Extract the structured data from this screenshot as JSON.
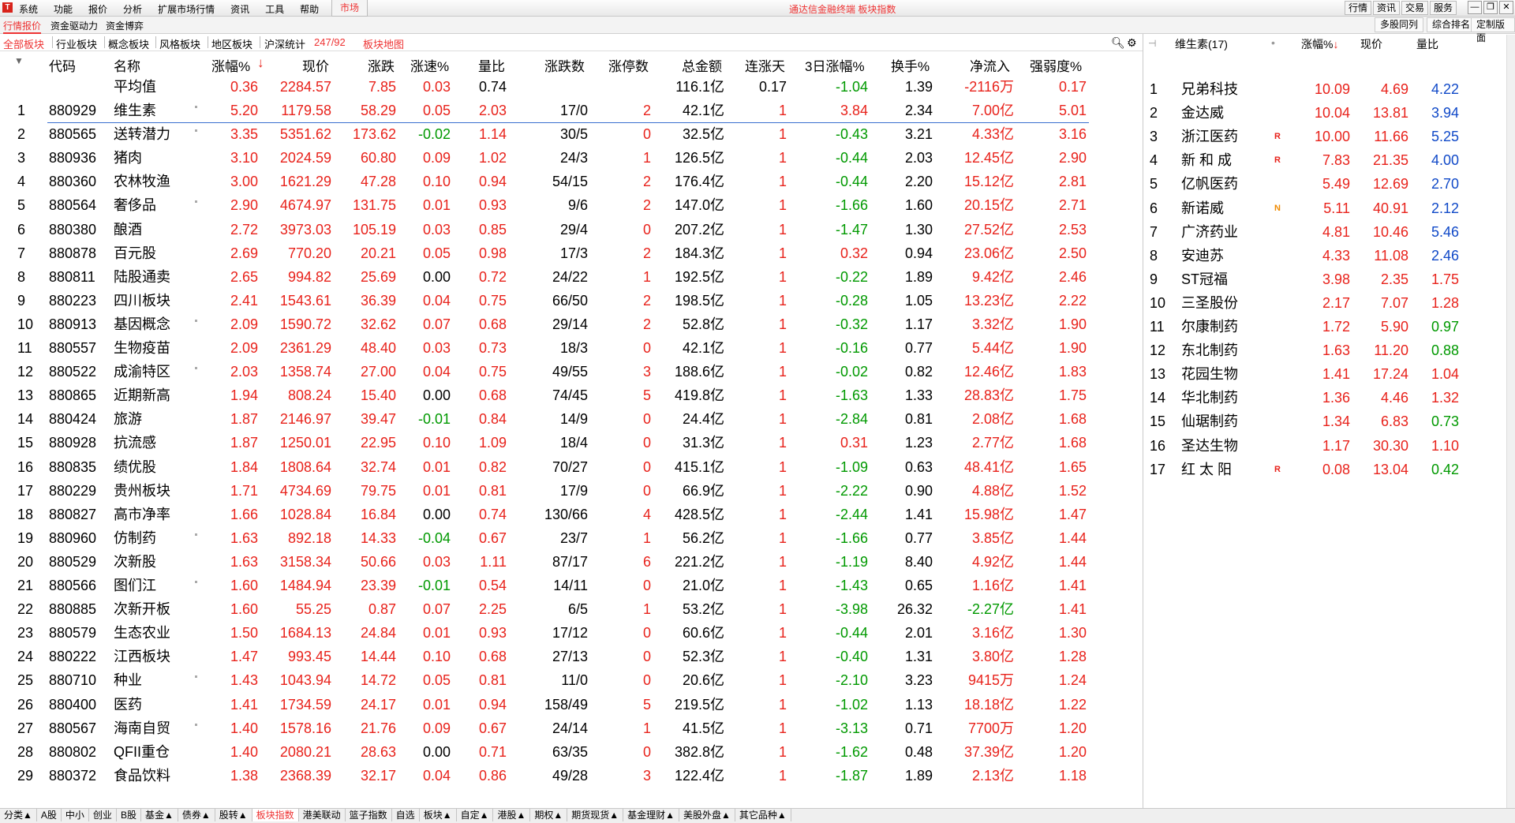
{
  "menubar": {
    "logo": "T",
    "items": [
      "系统",
      "功能",
      "报价",
      "分析",
      "扩展市场行情",
      "资讯",
      "工具",
      "帮助"
    ],
    "market": "市场",
    "title": "通达信金融终端  板块指数",
    "right_buttons": [
      "行情",
      "资讯",
      "交易",
      "服务"
    ],
    "win_buttons": [
      "—",
      "❐",
      "✕"
    ]
  },
  "bar2": {
    "tabs": [
      "行情报价",
      "资金驱动力",
      "资金博弈"
    ],
    "right": [
      "多股同列",
      "综合排名",
      "定制版面"
    ]
  },
  "bar3": {
    "tabs": [
      "全部板块",
      "行业板块",
      "概念板块",
      "风格板块",
      "地区板块",
      "沪深统计"
    ],
    "count": "247/92",
    "map": "板块地图"
  },
  "table": {
    "headers": [
      "代码",
      "名称",
      "涨幅%",
      "现价",
      "涨跌",
      "涨速%",
      "量比",
      "涨跌数",
      "涨停数",
      "总金额",
      "连涨天",
      "3日涨幅%",
      "换手%",
      "净流入",
      "强弱度%"
    ],
    "average": {
      "name": "平均值",
      "chg": "0.36",
      "price": "2284.57",
      "diff": "7.85",
      "speed": "0.03",
      "vr": "0.74",
      "count": "",
      "zt": "",
      "amount": "116.1亿",
      "days": "0.17",
      "d3": "-1.04",
      "turn": "1.39",
      "net": "-2116万",
      "strength": "0.17"
    },
    "rows": [
      [
        "1",
        "880929",
        "维生素",
        "5.20",
        "1179.58",
        "58.29",
        "0.05",
        "2.03",
        "17/0",
        "2",
        "42.1亿",
        "1",
        "3.84",
        "2.34",
        "7.00亿",
        "5.01"
      ],
      [
        "2",
        "880565",
        "送转潜力",
        "3.35",
        "5351.62",
        "173.62",
        "-0.02",
        "1.14",
        "30/5",
        "0",
        "32.5亿",
        "1",
        "-0.43",
        "3.21",
        "4.33亿",
        "3.16"
      ],
      [
        "3",
        "880936",
        "猪肉",
        "3.10",
        "2024.59",
        "60.80",
        "0.09",
        "1.02",
        "24/3",
        "1",
        "126.5亿",
        "1",
        "-0.44",
        "2.03",
        "12.45亿",
        "2.90"
      ],
      [
        "4",
        "880360",
        "农林牧渔",
        "3.00",
        "1621.29",
        "47.28",
        "0.10",
        "0.94",
        "54/15",
        "2",
        "176.4亿",
        "1",
        "-0.44",
        "2.20",
        "15.12亿",
        "2.81"
      ],
      [
        "5",
        "880564",
        "奢侈品",
        "2.90",
        "4674.97",
        "131.75",
        "0.01",
        "0.93",
        "9/6",
        "2",
        "147.0亿",
        "1",
        "-1.66",
        "1.60",
        "20.15亿",
        "2.71"
      ],
      [
        "6",
        "880380",
        "酿酒",
        "2.72",
        "3973.03",
        "105.19",
        "0.03",
        "0.85",
        "29/4",
        "0",
        "207.2亿",
        "1",
        "-1.47",
        "1.30",
        "27.52亿",
        "2.53"
      ],
      [
        "7",
        "880878",
        "百元股",
        "2.69",
        "770.20",
        "20.21",
        "0.05",
        "0.98",
        "17/3",
        "2",
        "184.3亿",
        "1",
        "0.32",
        "0.94",
        "23.06亿",
        "2.50"
      ],
      [
        "8",
        "880811",
        "陆股通卖",
        "2.65",
        "994.82",
        "25.69",
        "0.00",
        "0.72",
        "24/22",
        "1",
        "192.5亿",
        "1",
        "-0.22",
        "1.89",
        "9.42亿",
        "2.46"
      ],
      [
        "9",
        "880223",
        "四川板块",
        "2.41",
        "1543.61",
        "36.39",
        "0.04",
        "0.75",
        "66/50",
        "2",
        "198.5亿",
        "1",
        "-0.28",
        "1.05",
        "13.23亿",
        "2.22"
      ],
      [
        "10",
        "880913",
        "基因概念",
        "2.09",
        "1590.72",
        "32.62",
        "0.07",
        "0.68",
        "29/14",
        "2",
        "52.8亿",
        "1",
        "-0.32",
        "1.17",
        "3.32亿",
        "1.90"
      ],
      [
        "11",
        "880557",
        "生物疫苗",
        "2.09",
        "2361.29",
        "48.40",
        "0.03",
        "0.73",
        "18/3",
        "0",
        "42.1亿",
        "1",
        "-0.16",
        "0.77",
        "5.44亿",
        "1.90"
      ],
      [
        "12",
        "880522",
        "成渝特区",
        "2.03",
        "1358.74",
        "27.00",
        "0.04",
        "0.75",
        "49/55",
        "3",
        "188.6亿",
        "1",
        "-0.02",
        "0.82",
        "12.46亿",
        "1.83"
      ],
      [
        "13",
        "880865",
        "近期新高",
        "1.94",
        "808.24",
        "15.40",
        "0.00",
        "0.68",
        "74/45",
        "5",
        "419.8亿",
        "1",
        "-1.63",
        "1.33",
        "28.83亿",
        "1.75"
      ],
      [
        "14",
        "880424",
        "旅游",
        "1.87",
        "2146.97",
        "39.47",
        "-0.01",
        "0.84",
        "14/9",
        "0",
        "24.4亿",
        "1",
        "-2.84",
        "0.81",
        "2.08亿",
        "1.68"
      ],
      [
        "15",
        "880928",
        "抗流感",
        "1.87",
        "1250.01",
        "22.95",
        "0.10",
        "1.09",
        "18/4",
        "0",
        "31.3亿",
        "1",
        "0.31",
        "1.23",
        "2.77亿",
        "1.68"
      ],
      [
        "16",
        "880835",
        "绩优股",
        "1.84",
        "1808.64",
        "32.74",
        "0.01",
        "0.82",
        "70/27",
        "0",
        "415.1亿",
        "1",
        "-1.09",
        "0.63",
        "48.41亿",
        "1.65"
      ],
      [
        "17",
        "880229",
        "贵州板块",
        "1.71",
        "4734.69",
        "79.75",
        "0.01",
        "0.81",
        "17/9",
        "0",
        "66.9亿",
        "1",
        "-2.22",
        "0.90",
        "4.88亿",
        "1.52"
      ],
      [
        "18",
        "880827",
        "高市净率",
        "1.66",
        "1028.84",
        "16.84",
        "0.00",
        "0.74",
        "130/66",
        "4",
        "428.5亿",
        "1",
        "-2.44",
        "1.41",
        "15.98亿",
        "1.47"
      ],
      [
        "19",
        "880960",
        "仿制药",
        "1.63",
        "892.18",
        "14.33",
        "-0.04",
        "0.67",
        "23/7",
        "1",
        "56.2亿",
        "1",
        "-1.66",
        "0.77",
        "3.85亿",
        "1.44"
      ],
      [
        "20",
        "880529",
        "次新股",
        "1.63",
        "3158.34",
        "50.66",
        "0.03",
        "1.11",
        "87/17",
        "6",
        "221.2亿",
        "1",
        "-1.19",
        "8.40",
        "4.92亿",
        "1.44"
      ],
      [
        "21",
        "880566",
        "图们江",
        "1.60",
        "1484.94",
        "23.39",
        "-0.01",
        "0.54",
        "14/11",
        "0",
        "21.0亿",
        "1",
        "-1.43",
        "0.65",
        "1.16亿",
        "1.41"
      ],
      [
        "22",
        "880885",
        "次新开板",
        "1.60",
        "55.25",
        "0.87",
        "0.07",
        "2.25",
        "6/5",
        "1",
        "53.2亿",
        "1",
        "-3.98",
        "26.32",
        "-2.27亿",
        "1.41"
      ],
      [
        "23",
        "880579",
        "生态农业",
        "1.50",
        "1684.13",
        "24.84",
        "0.01",
        "0.93",
        "17/12",
        "0",
        "60.6亿",
        "1",
        "-0.44",
        "2.01",
        "3.16亿",
        "1.30"
      ],
      [
        "24",
        "880222",
        "江西板块",
        "1.47",
        "993.45",
        "14.44",
        "0.10",
        "0.68",
        "27/13",
        "0",
        "52.3亿",
        "1",
        "-0.40",
        "1.31",
        "3.80亿",
        "1.28"
      ],
      [
        "25",
        "880710",
        "种业",
        "1.43",
        "1043.94",
        "14.72",
        "0.05",
        "0.81",
        "11/0",
        "0",
        "20.6亿",
        "1",
        "-2.10",
        "3.23",
        "9415万",
        "1.24"
      ],
      [
        "26",
        "880400",
        "医药",
        "1.41",
        "1734.59",
        "24.17",
        "0.01",
        "0.94",
        "158/49",
        "5",
        "219.5亿",
        "1",
        "-1.02",
        "1.13",
        "18.18亿",
        "1.22"
      ],
      [
        "27",
        "880567",
        "海南自贸",
        "1.40",
        "1578.16",
        "21.76",
        "0.09",
        "0.67",
        "24/14",
        "1",
        "41.5亿",
        "1",
        "-3.13",
        "0.71",
        "7700万",
        "1.20"
      ],
      [
        "28",
        "880802",
        "QFII重仓",
        "1.40",
        "2080.21",
        "28.63",
        "0.00",
        "0.71",
        "63/35",
        "0",
        "382.8亿",
        "1",
        "-1.62",
        "0.48",
        "37.39亿",
        "1.20"
      ],
      [
        "29",
        "880372",
        "食品饮料",
        "1.38",
        "2368.39",
        "32.17",
        "0.04",
        "0.86",
        "49/28",
        "3",
        "122.4亿",
        "1",
        "-1.87",
        "1.89",
        "2.13亿",
        "1.18"
      ]
    ],
    "dot_rows": [
      1,
      2,
      5,
      10,
      12,
      19,
      21,
      25,
      27
    ]
  },
  "rpanel": {
    "title": "维生素(17)",
    "headers": [
      "涨幅%",
      "现价",
      "量比"
    ],
    "rows": [
      [
        "1",
        "兄弟科技",
        "",
        "10.09",
        "4.69",
        "4.22"
      ],
      [
        "2",
        "金达威",
        "",
        "10.04",
        "13.81",
        "3.94"
      ],
      [
        "3",
        "浙江医药",
        "R",
        "10.00",
        "11.66",
        "5.25"
      ],
      [
        "4",
        "新 和 成",
        "R",
        "7.83",
        "21.35",
        "4.00"
      ],
      [
        "5",
        "亿帆医药",
        "",
        "5.49",
        "12.69",
        "2.70"
      ],
      [
        "6",
        "新诺威",
        "N",
        "5.11",
        "40.91",
        "2.12"
      ],
      [
        "7",
        "广济药业",
        "",
        "4.81",
        "10.46",
        "5.46"
      ],
      [
        "8",
        "安迪苏",
        "",
        "4.33",
        "11.08",
        "2.46"
      ],
      [
        "9",
        "ST冠福",
        "",
        "3.98",
        "2.35",
        "1.75"
      ],
      [
        "10",
        "三圣股份",
        "",
        "2.17",
        "7.07",
        "1.28"
      ],
      [
        "11",
        "尔康制药",
        "",
        "1.72",
        "5.90",
        "0.97"
      ],
      [
        "12",
        "东北制药",
        "",
        "1.63",
        "11.20",
        "0.88"
      ],
      [
        "13",
        "花园生物",
        "",
        "1.41",
        "17.24",
        "1.04"
      ],
      [
        "14",
        "华北制药",
        "",
        "1.36",
        "4.46",
        "1.32"
      ],
      [
        "15",
        "仙琚制药",
        "",
        "1.34",
        "6.83",
        "0.73"
      ],
      [
        "16",
        "圣达生物",
        "",
        "1.17",
        "30.30",
        "1.10"
      ],
      [
        "17",
        "红 太 阳",
        "R",
        "0.08",
        "13.04",
        "0.42"
      ]
    ]
  },
  "bottom": {
    "tabs": [
      "分类▲",
      "A股",
      "中小",
      "创业",
      "B股",
      "基金▲",
      "债券▲",
      "股转▲",
      "板块指数",
      "港美联动",
      "篮子指数",
      "自选",
      "板块▲",
      "自定▲",
      "港股▲",
      "期权▲",
      "期货现货▲",
      "基金理财▲",
      "美股外盘▲",
      "其它品种▲"
    ],
    "active": 8
  },
  "colors": {
    "up": "#e8221b",
    "down": "#009900",
    "accent": "#1049c8"
  }
}
